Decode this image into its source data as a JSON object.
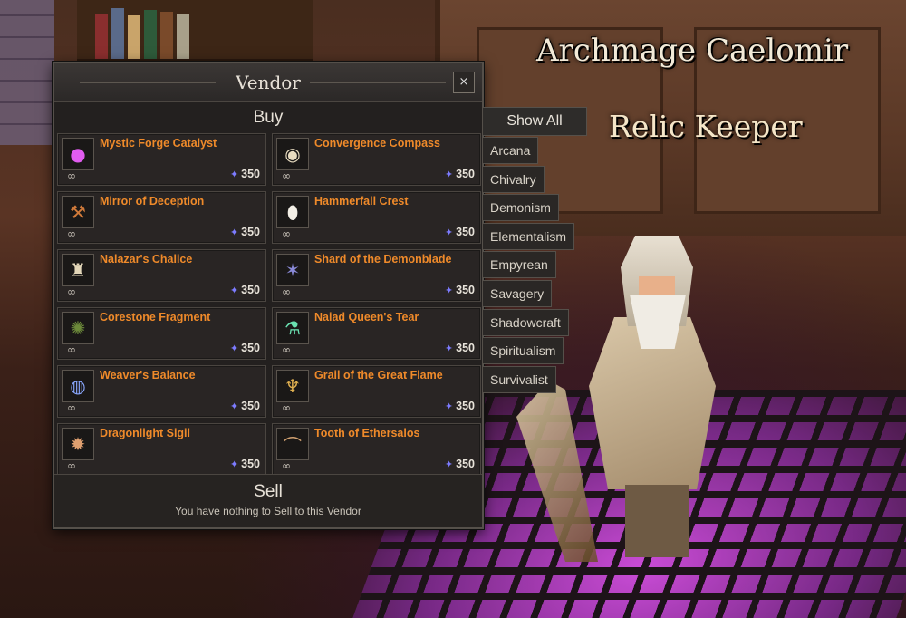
{
  "npc": {
    "name": "Archmage Caelomir",
    "title": "Relic Keeper"
  },
  "vendor": {
    "title": "Vendor",
    "close_label": "×",
    "buy_title": "Buy",
    "items": [
      {
        "name": "Mystic Forge Catalyst",
        "price": "350",
        "icon": "slime-orb-icon"
      },
      {
        "name": "Convergence Compass",
        "price": "350",
        "icon": "compass-icon"
      },
      {
        "name": "Mirror of Deception",
        "price": "350",
        "icon": "mace-icon"
      },
      {
        "name": "Hammerfall Crest",
        "price": "350",
        "icon": "crest-icon"
      },
      {
        "name": "Nalazar's Chalice",
        "price": "350",
        "icon": "chalice-icon"
      },
      {
        "name": "Shard of the Demonblade",
        "price": "350",
        "icon": "shard-icon"
      },
      {
        "name": "Corestone Fragment",
        "price": "350",
        "icon": "stone-icon"
      },
      {
        "name": "Naiad Queen's Tear",
        "price": "350",
        "icon": "vial-icon"
      },
      {
        "name": "Weaver's Balance",
        "price": "350",
        "icon": "orb-icon"
      },
      {
        "name": "Grail of the Great Flame",
        "price": "350",
        "icon": "grail-icon"
      },
      {
        "name": "Dragonlight Sigil",
        "price": "350",
        "icon": "sigil-icon"
      },
      {
        "name": "Tooth of Ethersalos",
        "price": "350",
        "icon": "tooth-icon"
      }
    ],
    "infinite_symbol": "∞",
    "currency_glyph": "✦",
    "sell_title": "Sell",
    "sell_message": "You have nothing to Sell to this Vendor"
  },
  "filters": {
    "show_all": "Show All",
    "items": [
      "Arcana",
      "Chivalry",
      "Demonism",
      "Elementalism",
      "Empyrean",
      "Savagery",
      "Shadowcraft",
      "Spiritualism",
      "Survivalist"
    ]
  },
  "colors": {
    "item_name": "#ef8a2a",
    "currency": "#7c7bff"
  }
}
